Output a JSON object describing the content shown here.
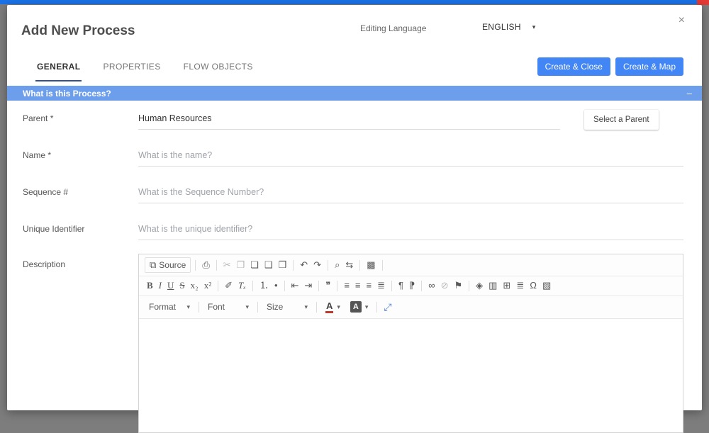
{
  "colors": {
    "accent_blue": "#4285f4",
    "section_header_blue": "#6d9eeb",
    "top_strip_blue": "#1a73e8",
    "badge_red": "#e53935",
    "active_tab_underline": "#35508e"
  },
  "header": {
    "title": "Add New Process",
    "editing_language_label": "Editing Language",
    "language_value": "ENGLISH",
    "caret_glyph": "▾",
    "close_glyph": "×"
  },
  "tabs": [
    {
      "label": "GENERAL",
      "active": true
    },
    {
      "label": "PROPERTIES",
      "active": false
    },
    {
      "label": "FLOW OBJECTS",
      "active": false
    }
  ],
  "actions": {
    "create_and_close": "Create & Close",
    "create_and_map": "Create & Map"
  },
  "section": {
    "title": "What is this Process?",
    "collapse_glyph": "–"
  },
  "form": {
    "parent": {
      "label": "Parent  *",
      "value": "Human Resources",
      "select_button": "Select a Parent"
    },
    "name": {
      "label": "Name *",
      "placeholder": "What is the name?"
    },
    "sequence": {
      "label": "Sequence #",
      "placeholder": "What is the Sequence Number?"
    },
    "unique_identifier": {
      "label": "Unique Identifier",
      "placeholder": "What is the unique identifier?"
    },
    "description": {
      "label": "Description"
    }
  },
  "editor": {
    "row1": [
      {
        "name": "source-button",
        "glyph": "⧉",
        "label": "Source"
      },
      {
        "name": "separator"
      },
      {
        "name": "print-icon",
        "glyph": "⎙"
      },
      {
        "name": "separator"
      },
      {
        "name": "cut-icon",
        "glyph": "✂"
      },
      {
        "name": "copy-icon",
        "glyph": "❐"
      },
      {
        "name": "paste-icon",
        "glyph": "❏"
      },
      {
        "name": "paste-text-icon",
        "glyph": "❑"
      },
      {
        "name": "paste-word-icon",
        "glyph": "❒"
      },
      {
        "name": "separator"
      },
      {
        "name": "undo-icon",
        "glyph": "↶"
      },
      {
        "name": "redo-icon",
        "glyph": "↷"
      },
      {
        "name": "separator"
      },
      {
        "name": "find-icon",
        "glyph": "⌕"
      },
      {
        "name": "replace-icon",
        "glyph": "⇆"
      },
      {
        "name": "separator"
      },
      {
        "name": "select-all-icon",
        "glyph": "▩"
      },
      {
        "name": "separator"
      }
    ],
    "row2": [
      {
        "name": "bold-button",
        "glyph": "B"
      },
      {
        "name": "italic-button",
        "glyph": "I"
      },
      {
        "name": "underline-button",
        "glyph": "U"
      },
      {
        "name": "strikethrough-button",
        "glyph": "S"
      },
      {
        "name": "subscript-button",
        "glyph": "x₂"
      },
      {
        "name": "superscript-button",
        "glyph": "x²"
      },
      {
        "name": "separator"
      },
      {
        "name": "copy-formatting-icon",
        "glyph": "✐"
      },
      {
        "name": "remove-format-icon",
        "glyph": "Tₓ"
      },
      {
        "name": "separator"
      },
      {
        "name": "numbered-list-icon",
        "glyph": "⒈"
      },
      {
        "name": "bulleted-list-icon",
        "glyph": "•"
      },
      {
        "name": "separator"
      },
      {
        "name": "decrease-indent-icon",
        "glyph": "⇤"
      },
      {
        "name": "increase-indent-icon",
        "glyph": "⇥"
      },
      {
        "name": "separator"
      },
      {
        "name": "blockquote-icon",
        "glyph": "❞"
      },
      {
        "name": "separator"
      },
      {
        "name": "align-left-icon",
        "glyph": "≡"
      },
      {
        "name": "align-center-icon",
        "glyph": "≡"
      },
      {
        "name": "align-right-icon",
        "glyph": "≡"
      },
      {
        "name": "align-justify-icon",
        "glyph": "≣"
      },
      {
        "name": "separator"
      },
      {
        "name": "text-direction-ltr-icon",
        "glyph": "¶"
      },
      {
        "name": "text-direction-rtl-icon",
        "glyph": "⁋"
      },
      {
        "name": "separator"
      },
      {
        "name": "link-icon",
        "glyph": "∞"
      },
      {
        "name": "unlink-icon",
        "glyph": "⊘"
      },
      {
        "name": "anchor-icon",
        "glyph": "⚑"
      },
      {
        "name": "separator"
      },
      {
        "name": "media-icon",
        "glyph": "◈"
      },
      {
        "name": "iframe-icon",
        "glyph": "▥"
      },
      {
        "name": "table-icon",
        "glyph": "⊞"
      },
      {
        "name": "page-break-icon",
        "glyph": "≣"
      },
      {
        "name": "special-character-icon",
        "glyph": "Ω"
      },
      {
        "name": "image-icon",
        "glyph": "▧"
      }
    ],
    "format_label": "Format",
    "font_label": "Font",
    "size_label": "Size",
    "text_color_glyph": "A",
    "bg_color_glyph": "A",
    "caret_glyph": "▾",
    "maximize_glyph": "⤢"
  }
}
